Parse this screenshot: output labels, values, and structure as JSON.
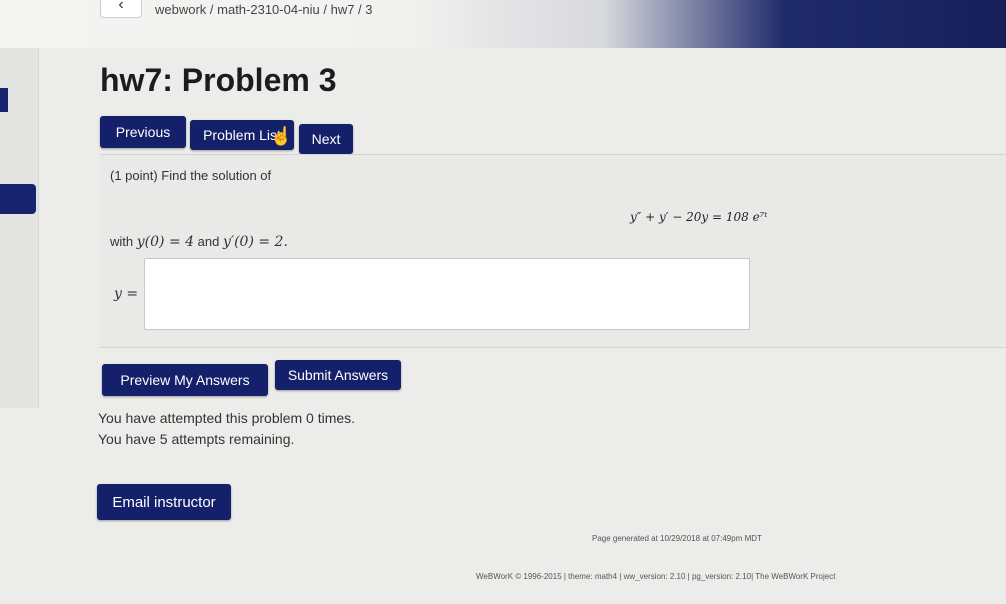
{
  "nav": {
    "back_glyph": "‹",
    "breadcrumb": "webwork / math-2310-04-niu / hw7 / 3"
  },
  "page": {
    "title": "hw7: Problem 3"
  },
  "problem_nav": {
    "previous_label": "Previous",
    "problem_list_label": "Problem List",
    "next_label": "Next"
  },
  "problem": {
    "prompt": "(1 point) Find the solution of",
    "equation": "y″ + y′ − 20y = 108 e⁷ᵗ",
    "with_text": "with",
    "ic1": "y(0) = 4",
    "and_text": "and",
    "ic2": "y′(0) = 2.",
    "answer_label": "y ="
  },
  "answer_input": {
    "value": "",
    "placeholder": ""
  },
  "actions": {
    "preview_label": "Preview My Answers",
    "submit_label": "Submit Answers"
  },
  "attempts": {
    "line1": "You have attempted this problem 0 times.",
    "line2": "You have 5 attempts remaining."
  },
  "email": {
    "label": "Email instructor"
  },
  "footer": {
    "generated": "Page generated at 10/29/2018 at 07:49pm MDT",
    "credits": "WeBWorK © 1996-2015 | theme: math4 | ww_version: 2.10 | pg_version: 2.10| The WeBWorK Project"
  },
  "colors": {
    "button": "#15206a",
    "background": "#ecedea"
  }
}
